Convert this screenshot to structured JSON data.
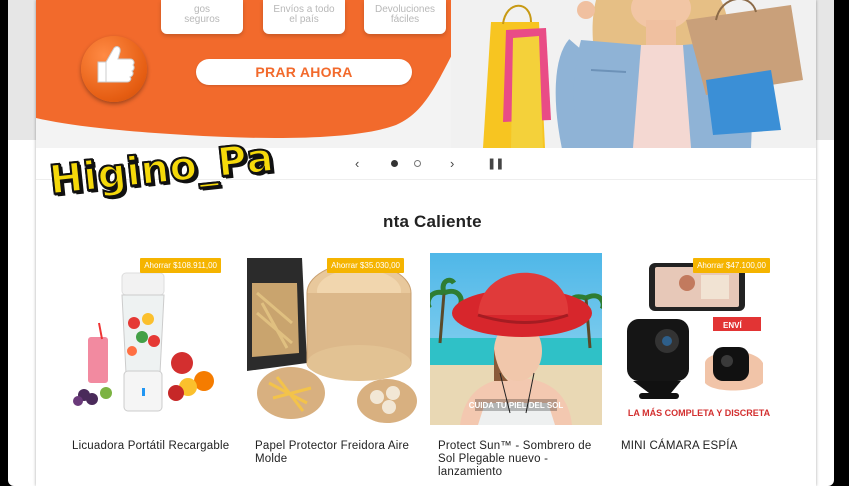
{
  "hero": {
    "features": [
      {
        "line1": "gos",
        "line2": "seguros"
      },
      {
        "line1": "Envíos a todo",
        "line2": "el país"
      },
      {
        "line1": "Devoluciones",
        "line2": "fáciles"
      }
    ],
    "buy_button_label": "PRAR AHORA",
    "accent_color": "#f26a2c"
  },
  "carousel": {
    "prev_icon": "chevron-left",
    "next_icon": "chevron-right",
    "pause_icon": "pause",
    "slides": 2,
    "active_slide": 1
  },
  "watermark": "Higino_Pa",
  "section": {
    "title": "nta Caliente"
  },
  "products": [
    {
      "name": "Licuadora Portátil Recargable",
      "badge": "Ahorrar $108.911,00"
    },
    {
      "name": "Papel Protector Freidora Aire Molde",
      "badge": "Ahorrar $35.030,00"
    },
    {
      "name": "Protect Sun™ - Sombrero de Sol Plegable nuevo - lanzamiento",
      "badge": "",
      "image_caption": "CUIDA TU PIEL DEL SOL"
    },
    {
      "name": "MINI CÁMARA ESPÍA",
      "badge": "Ahorrar $47.100,00",
      "image_caption": "LA MÁS COMPLETA Y DISCRETA",
      "image_tag": "ENVÍ"
    }
  ],
  "colors": {
    "badge": "#f5b400",
    "watermark_fill": "#f5d90a"
  }
}
